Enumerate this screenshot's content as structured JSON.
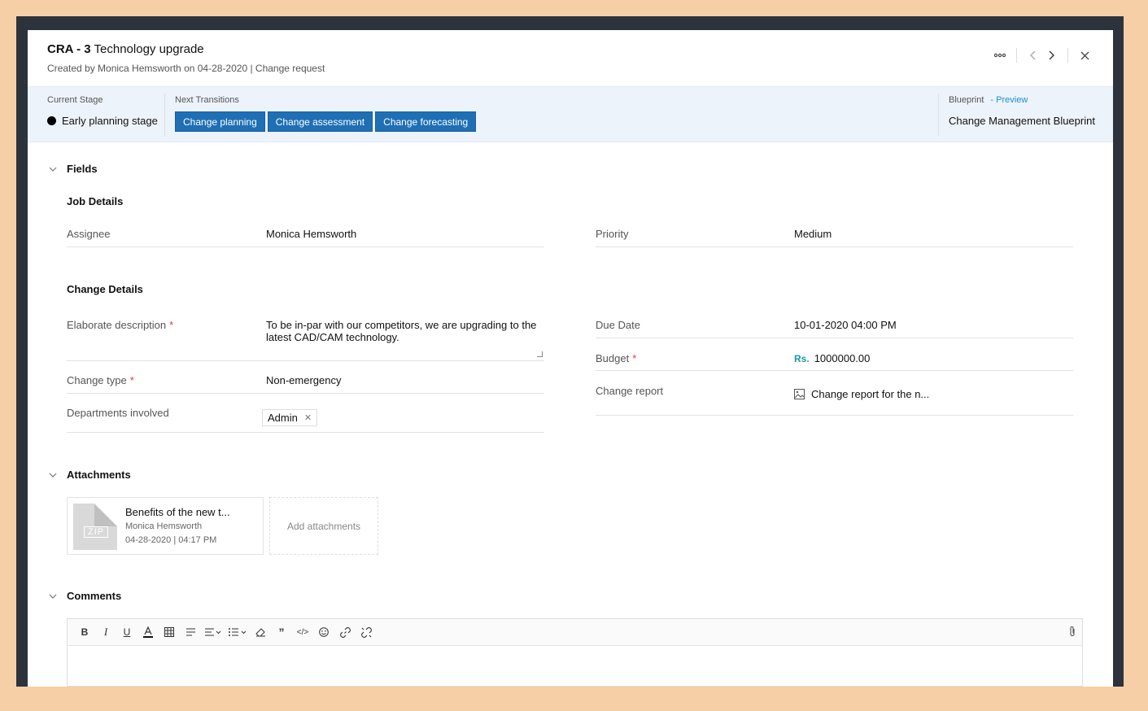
{
  "header": {
    "id": "CRA - 3",
    "title": "Technology upgrade",
    "subtitle": "Created by  Monica Hemsworth  on 04-28-2020 | Change request",
    "more_icon": "more-horizontal-icon",
    "prev_icon": "chevron-left-icon",
    "next_icon": "chevron-right-icon",
    "close_icon": "close-icon"
  },
  "stagebar": {
    "current_stage_label": "Current Stage",
    "current_stage": "Early planning stage",
    "next_transitions_label": "Next Transitions",
    "transitions": [
      "Change planning",
      "Change assessment",
      "Change forecasting"
    ],
    "blueprint_label": "Blueprint",
    "blueprint_preview": "- Preview",
    "blueprint_name": "Change Management Blueprint"
  },
  "fields": {
    "section_title": "Fields",
    "job_details": {
      "title": "Job Details",
      "assignee_label": "Assignee",
      "assignee": "Monica Hemsworth",
      "priority_label": "Priority",
      "priority": "Medium"
    },
    "change_details": {
      "title": "Change Details",
      "description_label": "Elaborate description",
      "description": "To be in-par with our competitors, we are upgrading to the latest CAD/CAM technology.",
      "change_type_label": "Change type",
      "change_type": "Non-emergency",
      "departments_label": "Departments involved",
      "department_tag": "Admin",
      "due_date_label": "Due Date",
      "due_date": "10-01-2020 04:00 PM",
      "budget_label": "Budget",
      "budget_currency": "Rs.",
      "budget": "1000000.00",
      "report_label": "Change report",
      "report_file": "Change report for the n..."
    },
    "required_mark": "*"
  },
  "attachments": {
    "section_title": "Attachments",
    "file_name": "Benefits of the new t...",
    "file_type": "ZIP",
    "uploaded_by": "Monica Hemsworth",
    "uploaded_at": "04-28-2020 | 04:17 PM",
    "add_label": "Add attachments"
  },
  "comments": {
    "section_title": "Comments",
    "toolbar": [
      "bold-icon",
      "italic-icon",
      "underline-icon",
      "font-color-icon",
      "table-icon",
      "strikethrough-icon",
      "align-icon",
      "list-icon",
      "clear-format-icon",
      "quote-icon",
      "code-icon",
      "emoji-icon",
      "link-icon",
      "unlink-icon",
      "attach-icon"
    ]
  }
}
